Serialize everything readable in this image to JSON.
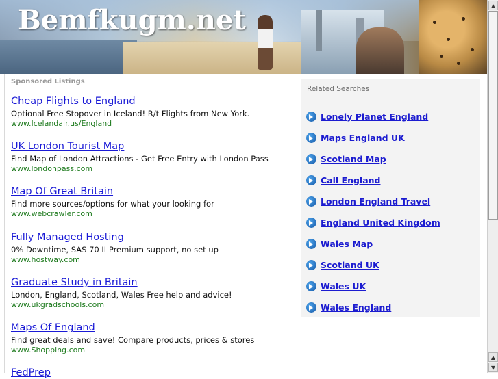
{
  "header": {
    "site_title": "Bemfkugm.net"
  },
  "sponsored": {
    "heading": "Sponsored Listings",
    "listings": [
      {
        "title": "Cheap Flights to England",
        "description": "Optional Free Stopover in Iceland! R/t Flights from New York.",
        "url": "www.Icelandair.us/England"
      },
      {
        "title": "UK London Tourist Map",
        "description": "Find Map of London Attractions - Get Free Entry with London Pass",
        "url": "www.londonpass.com"
      },
      {
        "title": "Map Of Great Britain",
        "description": "Find more sources/options for what your looking for",
        "url": "www.webcrawler.com"
      },
      {
        "title": "Fully Managed Hosting",
        "description": "0% Downtime, SAS 70 II Premium support, no set up",
        "url": "www.hostway.com"
      },
      {
        "title": "Graduate Study in Britain",
        "description": "London, England, Scotland, Wales Free help and advice!",
        "url": "www.ukgradschools.com"
      },
      {
        "title": "Maps Of England",
        "description": "Find great deals and save! Compare products, prices & stores",
        "url": "www.Shopping.com"
      },
      {
        "title": "FedPrep",
        "description": "",
        "url": ""
      }
    ]
  },
  "related": {
    "heading": "Related Searches",
    "items": [
      "Lonely Planet England",
      "Maps England UK",
      "Scotland Map",
      "Call England",
      "London England Travel",
      "England United Kingdom",
      "Wales Map",
      "Scotland UK",
      "Wales UK",
      "Wales England"
    ],
    "icon": "arrow-circle-icon"
  },
  "scrollbar": {
    "up_icon": "scroll-up-icon",
    "down_icon": "scroll-down-icon"
  },
  "colors": {
    "link": "#1a1ad6",
    "url": "#1d7a1d",
    "related_bg": "#f3f3f3"
  }
}
